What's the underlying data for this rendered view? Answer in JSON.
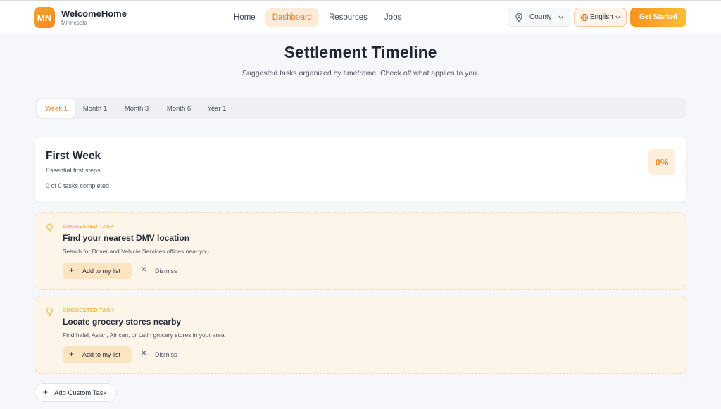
{
  "header": {
    "logo_initials": "MN",
    "brand_name": "WelcomeHome",
    "brand_sub": "Minnesota",
    "nav": [
      "Home",
      "Dashboard",
      "Resources",
      "Jobs"
    ],
    "active_nav": "Dashboard",
    "county_label": "County",
    "language_label": "English",
    "cta_label": "Get Started"
  },
  "page": {
    "title": "Settlement Timeline",
    "subtitle": "Suggested tasks organized by timeframe. Check off what applies to you."
  },
  "tabs": [
    "Week 1",
    "Month 1",
    "Month 3",
    "Month 6",
    "Year 1"
  ],
  "active_tab": "Week 1",
  "summary": {
    "title": "First Week",
    "subtitle": "Essential first steps",
    "progress_text": "0 of 0 tasks completed",
    "percent_label": "0%"
  },
  "tasks": [
    {
      "kicker": "SUGGESTED TASK",
      "title": "Find your nearest DMV location",
      "description": "Search for Driver and Vehicle Services offices near you",
      "add_label": "Add to my list",
      "dismiss_label": "Dismiss"
    },
    {
      "kicker": "SUGGESTED TASK",
      "title": "Locate grocery stores nearby",
      "description": "Find halal, Asian, African, or Latin grocery stores in your area",
      "add_label": "Add to my list",
      "dismiss_label": "Dismiss"
    }
  ],
  "add_custom_label": "Add Custom Task",
  "icons": {
    "county": "map-pin-icon",
    "language": "globe-icon",
    "task": "lightbulb-icon",
    "add": "plus-icon",
    "dismiss": "close-icon"
  },
  "colors": {
    "accent": "#f58a1f",
    "accent_light": "#fdebd9",
    "task_bg": "#fdf5ea",
    "kicker": "#f4b43a"
  }
}
